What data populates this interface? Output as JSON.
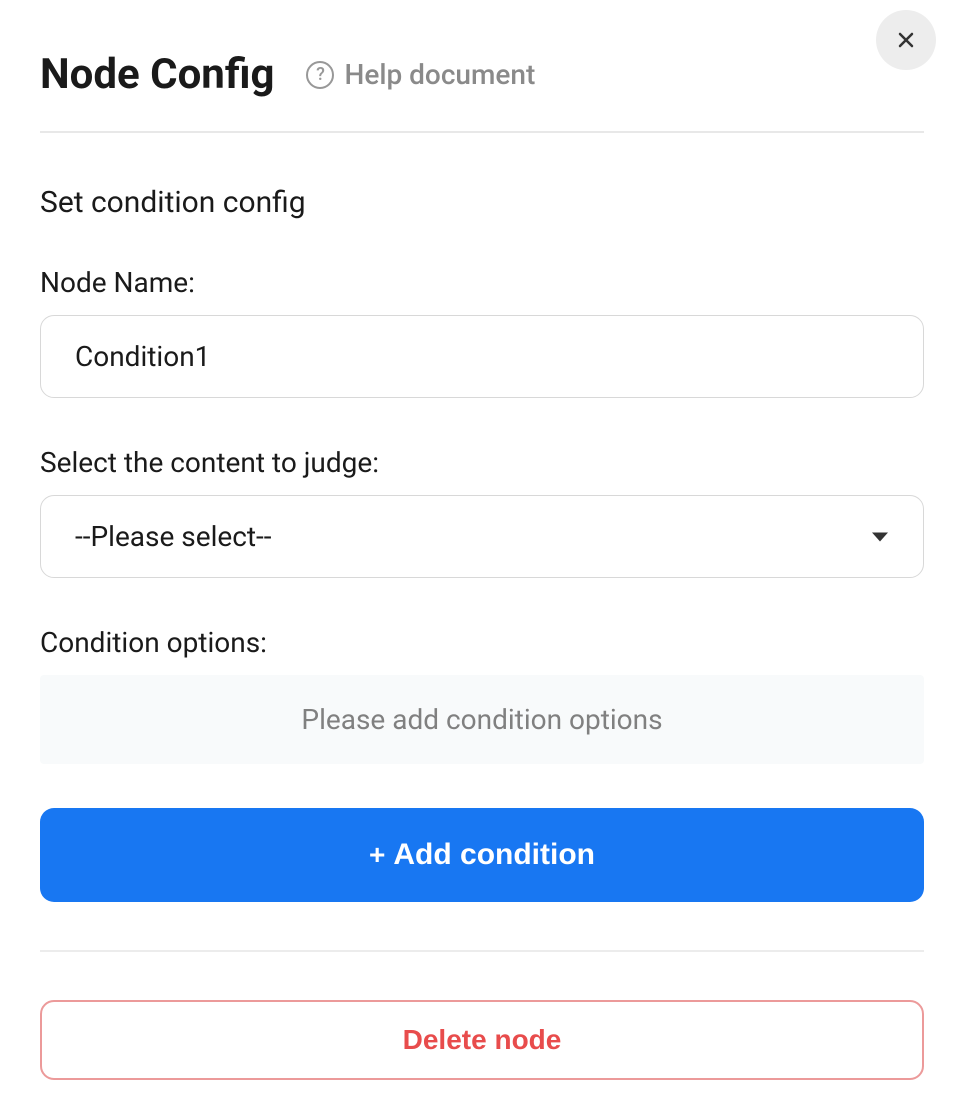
{
  "header": {
    "title": "Node Config",
    "help_label": "Help document"
  },
  "section": {
    "label": "Set condition config"
  },
  "node_name": {
    "label": "Node Name:",
    "value": "Condition1"
  },
  "content_judge": {
    "label": "Select the content to judge:",
    "placeholder": "--Please select--"
  },
  "condition_options": {
    "label": "Condition options:",
    "empty_text": "Please add condition options"
  },
  "buttons": {
    "add_condition": "Add condition",
    "delete_node": "Delete node"
  }
}
